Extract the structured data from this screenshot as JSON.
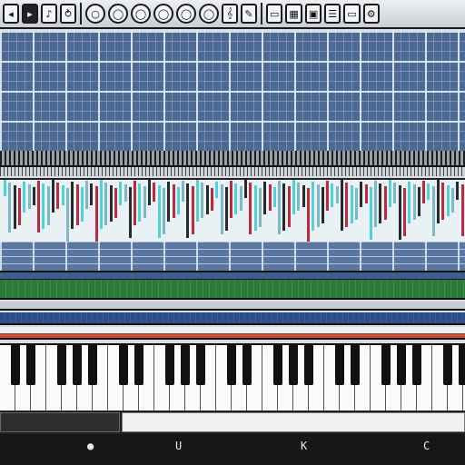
{
  "toolbar": {
    "buttons": [
      {
        "icon": "rewind-icon",
        "glyph": "◂"
      },
      {
        "icon": "play-icon",
        "glyph": "▸"
      },
      {
        "icon": "note-icon",
        "glyph": "♪"
      },
      {
        "icon": "loop-icon",
        "glyph": "⥁"
      },
      {
        "icon": "record-icon",
        "glyph": "○"
      },
      {
        "icon": "knob-1-icon",
        "glyph": "◯"
      },
      {
        "icon": "knob-2-icon",
        "glyph": "◯"
      },
      {
        "icon": "knob-3-icon",
        "glyph": "◯"
      },
      {
        "icon": "knob-4-icon",
        "glyph": "◯"
      },
      {
        "icon": "knob-5-icon",
        "glyph": "◯"
      },
      {
        "icon": "clef-icon",
        "glyph": "𝄞"
      },
      {
        "icon": "tool-icon",
        "glyph": "✎"
      },
      {
        "icon": "screen-icon",
        "glyph": "▭"
      },
      {
        "icon": "grid-icon",
        "glyph": "▦"
      },
      {
        "icon": "panel-icon",
        "glyph": "▣"
      },
      {
        "icon": "mixer-icon",
        "glyph": "☰"
      },
      {
        "icon": "window-icon",
        "glyph": "▭"
      },
      {
        "icon": "settings-icon",
        "glyph": "⚙"
      }
    ]
  },
  "status": {
    "items": [
      {
        "icon": "status-dot-icon",
        "glyph": "●"
      },
      {
        "icon": "status-u-icon",
        "glyph": "U"
      },
      {
        "icon": "status-k-icon",
        "glyph": "K"
      },
      {
        "icon": "status-end-icon",
        "glyph": "C"
      }
    ]
  },
  "colors": {
    "grid": "#4d6a94",
    "note_red": "#c0283e",
    "note_cyan": "#4fd3d8",
    "lane_green": "#2f7a3a",
    "lane_red": "#d84a2a"
  }
}
